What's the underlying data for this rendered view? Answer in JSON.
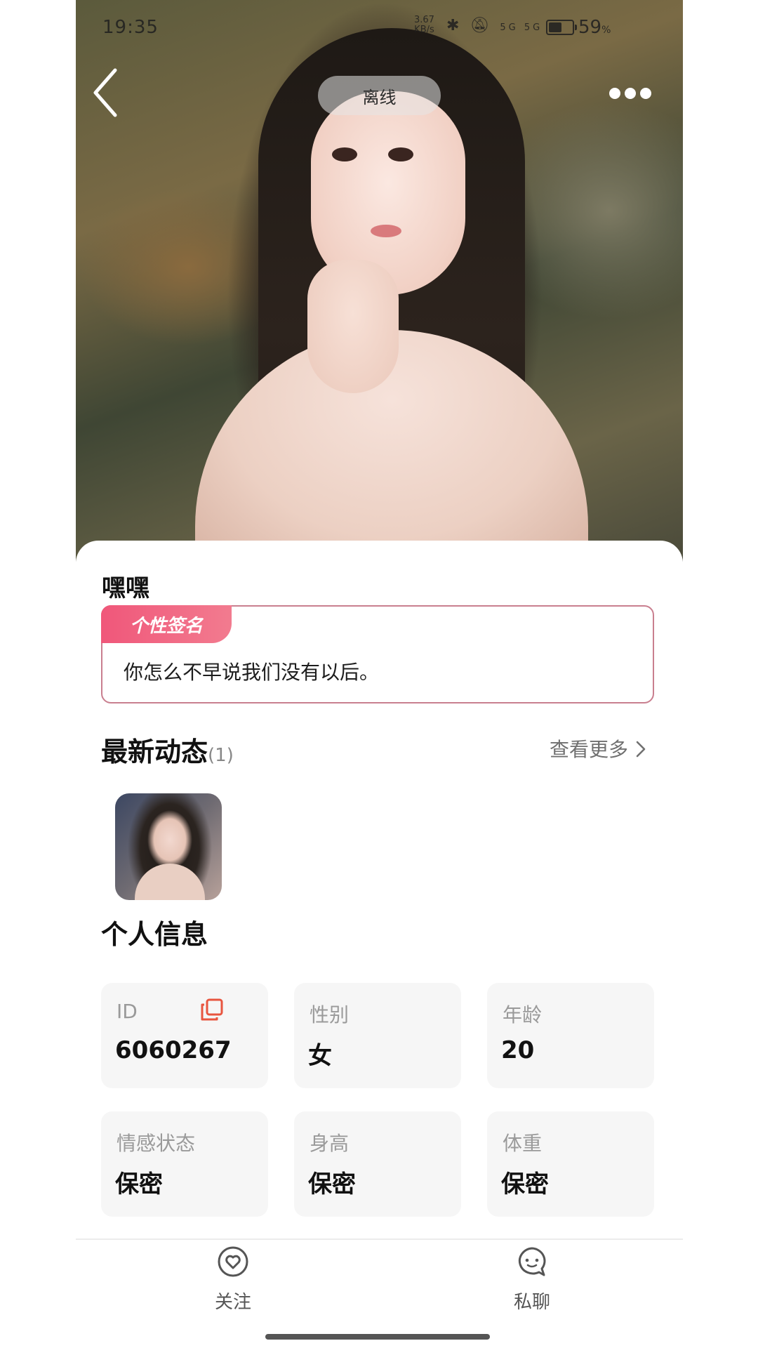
{
  "status_bar": {
    "time": "19:35",
    "net_speed_top": "3.67",
    "net_speed_unit": "KB/s",
    "network_icons": "5G  5G",
    "battery_value": "59",
    "battery_unit": "%"
  },
  "header": {
    "status_pill": "离线"
  },
  "profile": {
    "nickname": "嘿嘿",
    "signature_tag": "个性签名",
    "signature_text": "你怎么不早说我们没有以后。"
  },
  "moments": {
    "title": "最新动态",
    "count": "(1)",
    "see_more": "查看更多"
  },
  "personal_info": {
    "title": "个人信息",
    "fields": [
      {
        "label": "ID",
        "value": "6060267"
      },
      {
        "label": "性别",
        "value": "女"
      },
      {
        "label": "年龄",
        "value": "20"
      },
      {
        "label": "情感状态",
        "value": "保密"
      },
      {
        "label": "身高",
        "value": "保密"
      },
      {
        "label": "体重",
        "value": "保密"
      }
    ]
  },
  "bottom_bar": {
    "follow_label": "关注",
    "chat_label": "私聊"
  },
  "colors": {
    "accent_pink": "#f0577a",
    "signature_border": "#c97f8f",
    "copy_icon": "#e8553f"
  }
}
